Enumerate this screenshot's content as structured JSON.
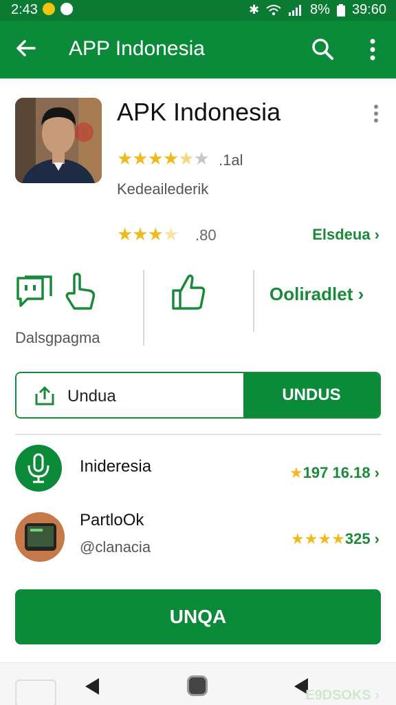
{
  "status_bar": {
    "time": "2:43",
    "battery_percent": "8%",
    "clock_right": "39:60",
    "icons": [
      "notification-dot-icon",
      "chat-bubble-icon",
      "bluetooth-icon",
      "wifi-icon",
      "signal-icon",
      "battery-icon"
    ]
  },
  "app_bar": {
    "title": "APP Indonesia",
    "icons": [
      "back-arrow-icon",
      "search-icon",
      "overflow-menu-icon"
    ]
  },
  "app_card": {
    "name": "APK Indonesia",
    "rating_1": {
      "stars": "★★★★",
      "half": "★",
      "empty": "★",
      "value": ".1al",
      "fraction": 0.8
    },
    "developer": "Kedeailederik",
    "rating_2": {
      "stars": "★★★",
      "half": "★",
      "value": ".80",
      "fraction": 0.7
    },
    "link_1": "Elsdeua ›",
    "link_2": "Ooliradlet ›"
  },
  "actions": {
    "label": "Dalsgpagma",
    "icons": [
      "chat-icon",
      "hand-pointer-icon",
      "like-icon"
    ]
  },
  "split_button": {
    "left_label": "Undua",
    "right_label": "UNDUS"
  },
  "list": [
    {
      "title": "Inideresia",
      "subtitle": "",
      "right_stars": "★",
      "right_value": "197 16.18 ›",
      "icon": "microphone-icon"
    },
    {
      "title": "PartloOk",
      "subtitle": "@clanacia",
      "right_stars": "★★★★",
      "right_value": "325 ›",
      "icon": "phone-thumbnail"
    }
  ],
  "primary_button": {
    "label": "UNQA"
  },
  "nav_bar": {
    "faded_text": "E9DSOKS ›",
    "icons": [
      "back-triangle-icon",
      "home-icon",
      "back-triangle-icon"
    ]
  },
  "colors": {
    "brand_green": "#0b8a3a",
    "dark_green": "#0b7a33",
    "star_gold": "#f0b91e"
  }
}
